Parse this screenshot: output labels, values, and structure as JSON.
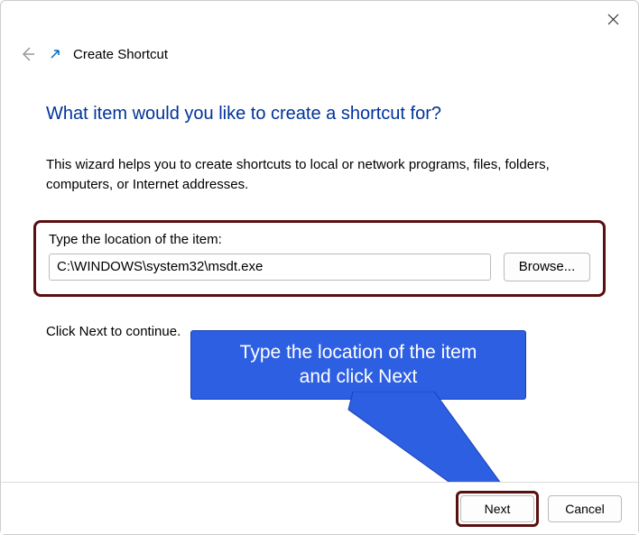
{
  "titlebar": {
    "close_tooltip": "Close"
  },
  "header": {
    "wizard_title": "Create Shortcut"
  },
  "main": {
    "heading": "What item would you like to create a shortcut for?",
    "description": "This wizard helps you to create shortcuts to local or network programs, files, folders, computers, or Internet addresses.",
    "location_label": "Type the location of the item:",
    "location_value": "C:\\WINDOWS\\system32\\msdt.exe",
    "browse_label": "Browse...",
    "continue_text": "Click Next to continue."
  },
  "callout": {
    "text_line1": "Type the location of the item",
    "text_line2": "and click Next"
  },
  "footer": {
    "next_label": "Next",
    "cancel_label": "Cancel"
  }
}
